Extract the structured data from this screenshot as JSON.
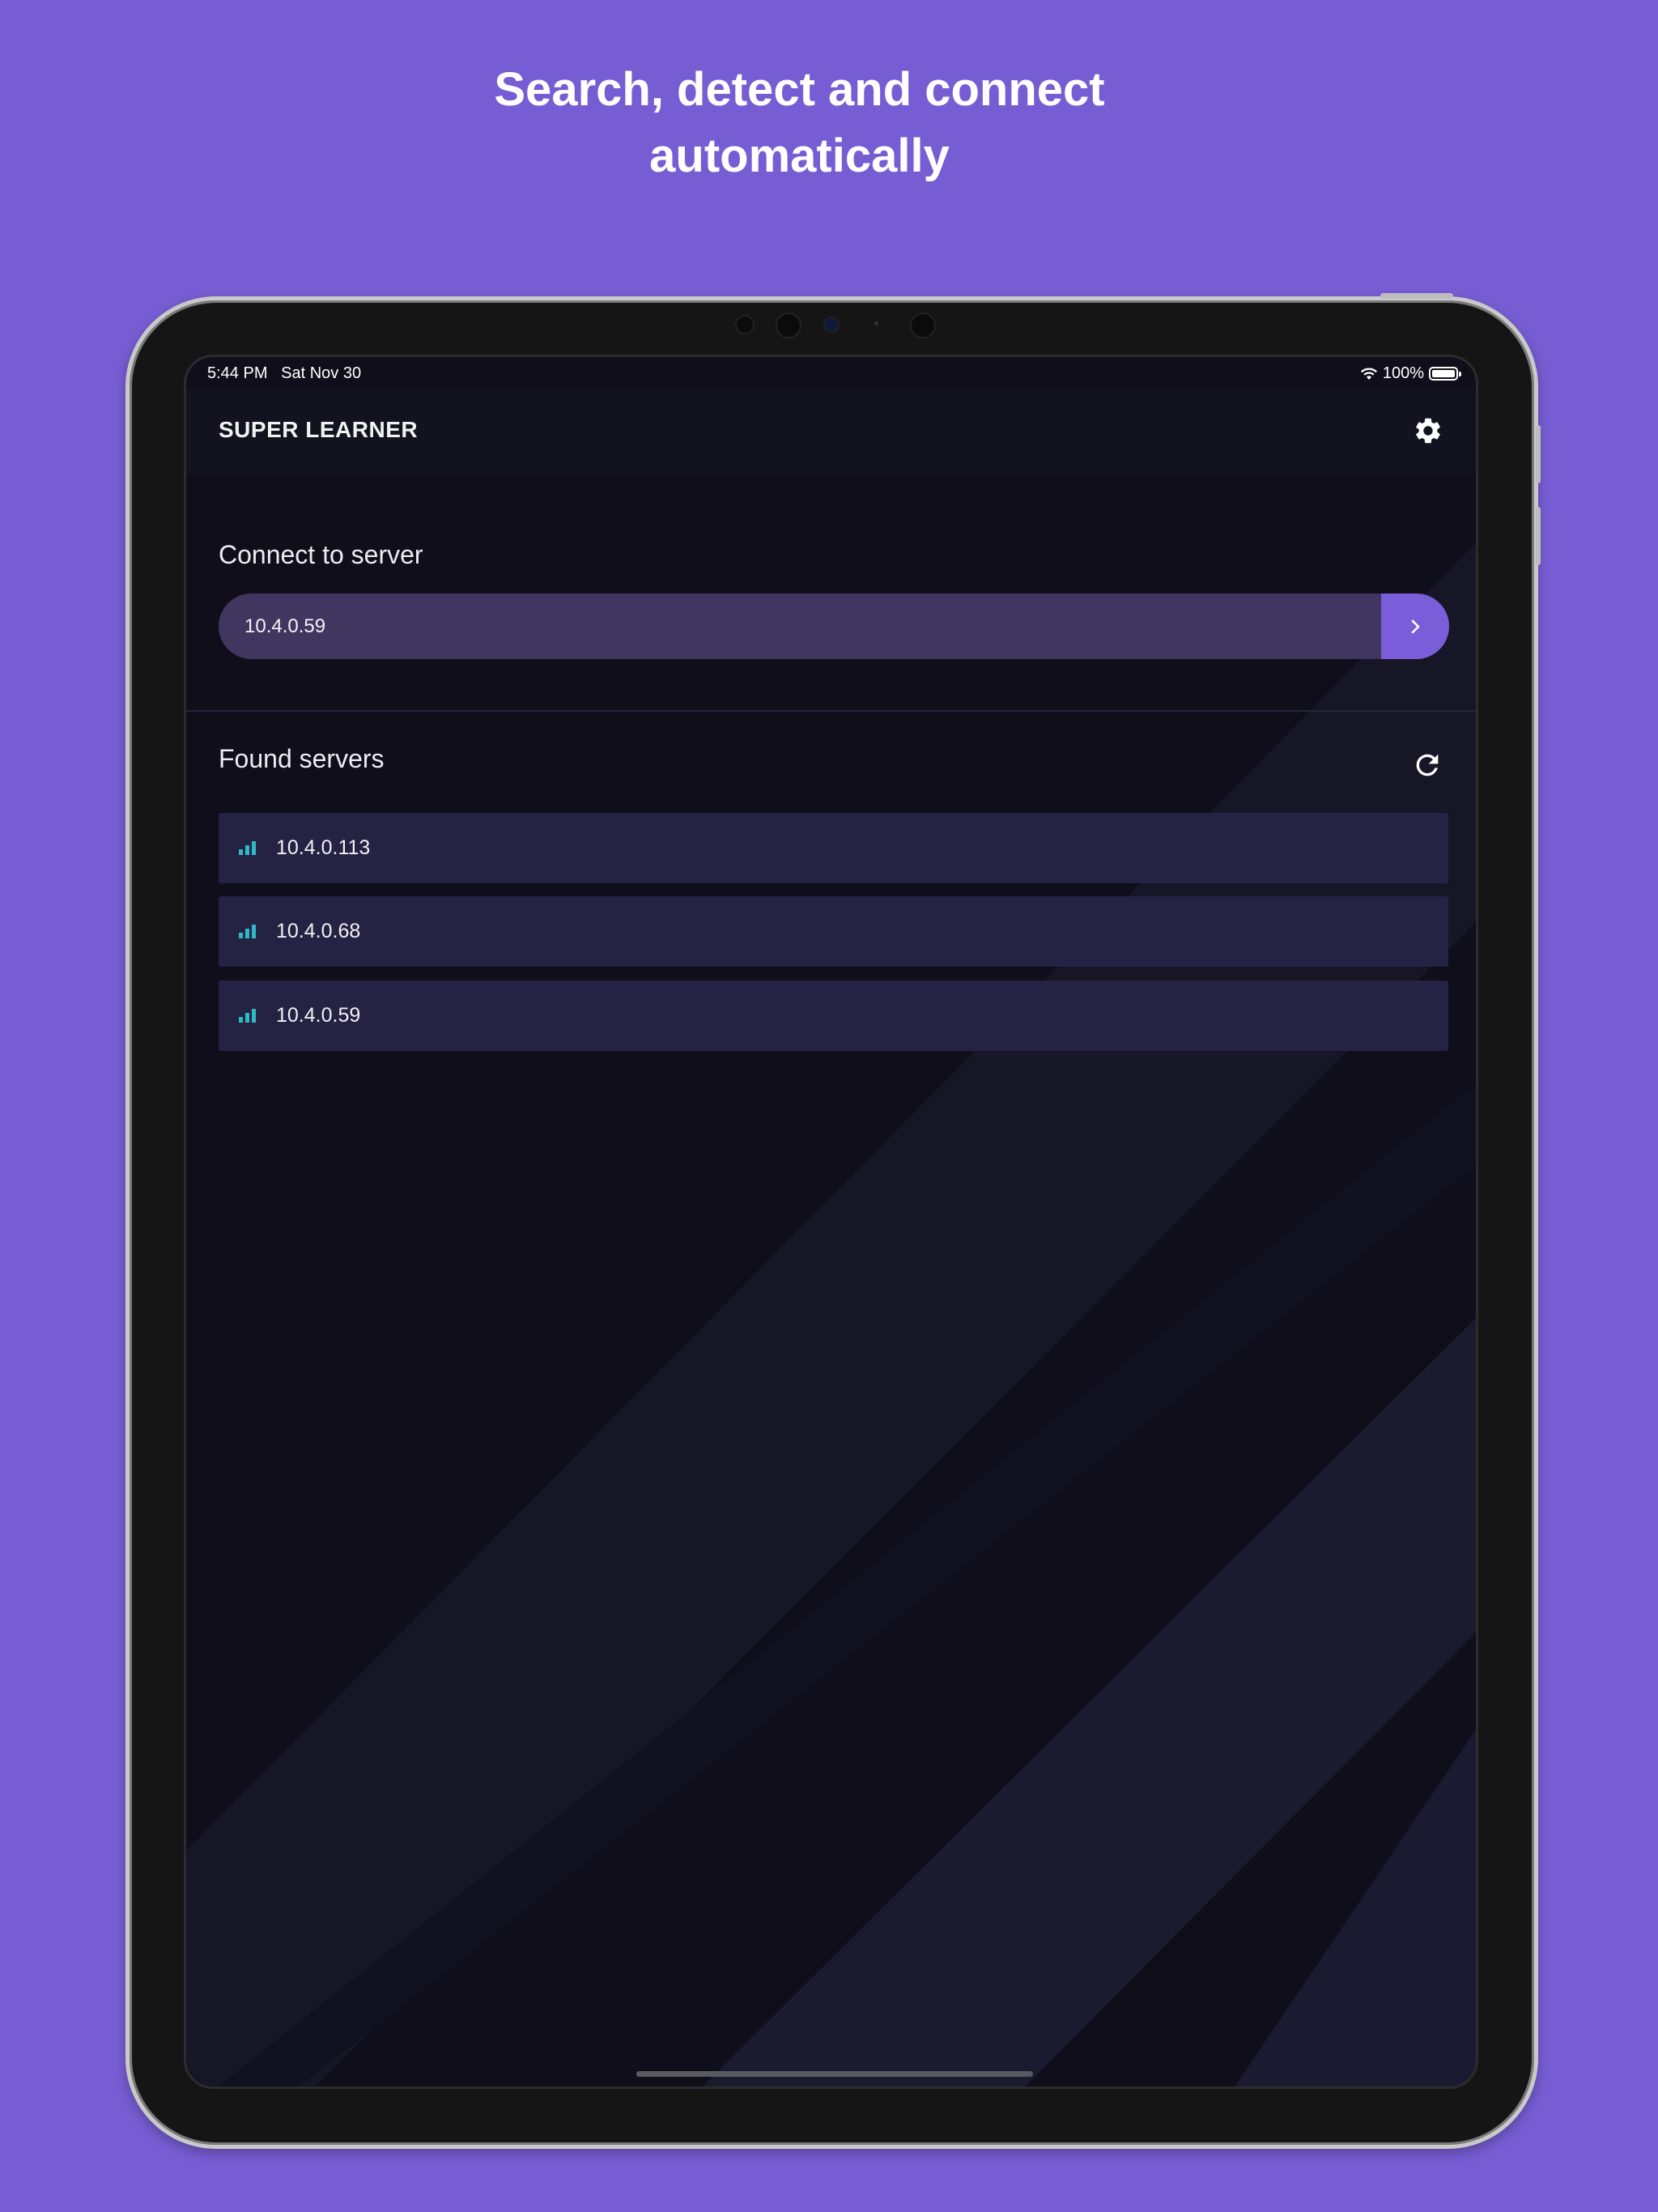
{
  "headline": {
    "line1": "Search, detect and connect",
    "line2": "automatically"
  },
  "status_bar": {
    "time": "5:44 PM",
    "date": "Sat Nov 30",
    "battery": "100%",
    "battery_level": 1.0,
    "wifi_icon": "wifi-icon",
    "battery_icon": "battery-icon"
  },
  "app": {
    "title": "SUPER LEARNER",
    "settings_icon": "gear-icon"
  },
  "connect": {
    "label": "Connect to server",
    "input_value": "10.4.0.59",
    "go_icon": "chevron-right-icon"
  },
  "found": {
    "label": "Found servers",
    "refresh_icon": "refresh-icon",
    "servers": [
      {
        "ip": "10.4.0.113",
        "icon": "signal-icon"
      },
      {
        "ip": "10.4.0.68",
        "icon": "signal-icon"
      },
      {
        "ip": "10.4.0.59",
        "icon": "signal-icon"
      }
    ]
  },
  "colors": {
    "page_background": "#775dd3",
    "accent": "#7a5dd8",
    "signal": "#2fb8c6",
    "screen_background": "#0f0e1a",
    "card": "#252343"
  }
}
